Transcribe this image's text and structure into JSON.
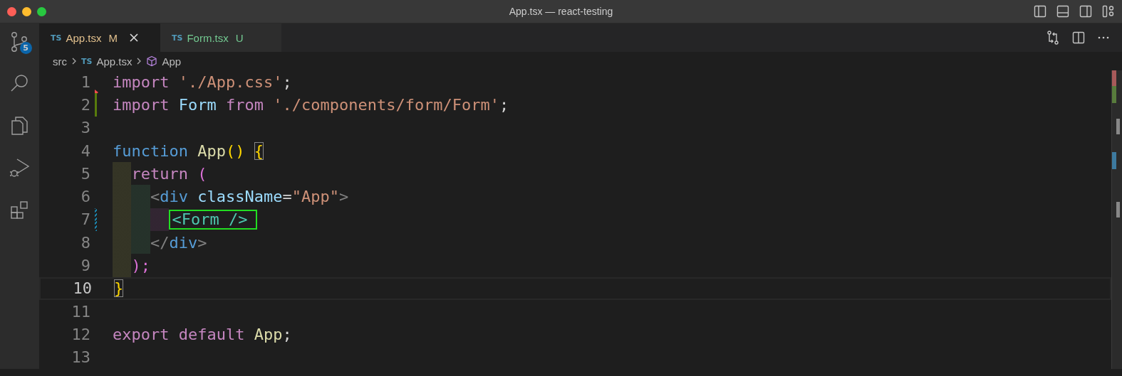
{
  "window": {
    "title": "App.tsx — react-testing"
  },
  "activity_bar": [
    {
      "kind": "source-control",
      "badge": "5",
      "selected": false
    },
    {
      "kind": "search",
      "selected": false
    },
    {
      "kind": "explorer",
      "selected": false
    },
    {
      "kind": "run-debug",
      "selected": false
    },
    {
      "kind": "extensions",
      "selected": false
    }
  ],
  "tabs": [
    {
      "icon": "TS",
      "label": "App.tsx",
      "status": "M",
      "color": "#e2c08d",
      "selected": true
    },
    {
      "icon": "TS",
      "label": "Form.tsx",
      "status": "U",
      "color": "#73c991",
      "selected": false
    }
  ],
  "breadcrumb": {
    "folder": "src",
    "file_icon": "TS",
    "file": "App.tsx",
    "symbol": "App"
  },
  "lines": [
    {
      "number": "1",
      "kind": "deleted",
      "current": false,
      "tokens": [
        {
          "text": "import",
          "kind": "keyword"
        },
        {
          "text": " './App.css'",
          "kind": "string"
        },
        {
          "text": ";"
        }
      ]
    },
    {
      "number": "2",
      "kind": "added",
      "current": false,
      "tokens": [
        {
          "text": "import",
          "kind": "keyword"
        },
        {
          "text": " Form",
          "kind": "variable"
        },
        {
          "text": " from",
          "kind": "keyword"
        },
        {
          "text": " './components/form/Form'",
          "kind": "string"
        },
        {
          "text": ";"
        }
      ]
    },
    {
      "number": "3",
      "kind": "plain",
      "current": false
    },
    {
      "number": "4",
      "kind": "plain",
      "current": false,
      "tokens": [
        {
          "text": "function",
          "kind": "storage"
        },
        {
          "text": " App",
          "kind": "function"
        },
        {
          "text": "() ",
          "kind": "bracket1"
        },
        {
          "text": "{",
          "kind": "bracket1",
          "bracket_match": true
        }
      ]
    },
    {
      "number": "5",
      "kind": "plain",
      "current": false,
      "tokens": [
        {
          "text": "  return",
          "kind": "keyword"
        },
        {
          "text": " (",
          "kind": "bracket2"
        }
      ]
    },
    {
      "number": "6",
      "kind": "plain",
      "current": false,
      "tokens": [
        {
          "text": "    <",
          "kind": "punct"
        },
        {
          "text": "div",
          "kind": "tag"
        },
        {
          "text": " className",
          "kind": "variable"
        },
        {
          "text": "="
        },
        {
          "text": "\"App\"",
          "kind": "string"
        },
        {
          "text": ">",
          "kind": "punct"
        }
      ]
    },
    {
      "number": "7",
      "kind": "modified",
      "current": false,
      "tokens": [
        {
          "text": "      <Form />",
          "kind": "component",
          "boxed": true
        }
      ]
    },
    {
      "number": "8",
      "kind": "plain",
      "current": false,
      "tokens": [
        {
          "text": "    </",
          "kind": "punct"
        },
        {
          "text": "div",
          "kind": "tag"
        },
        {
          "text": ">",
          "kind": "punct"
        }
      ]
    },
    {
      "number": "9",
      "kind": "plain",
      "current": false,
      "tokens": [
        {
          "text": "  );",
          "kind": "bracket2"
        }
      ]
    },
    {
      "number": "10",
      "kind": "plain",
      "current": true,
      "tokens": [
        {
          "text": "}",
          "kind": "bracket1",
          "bracket_match": true
        }
      ]
    },
    {
      "number": "11",
      "kind": "plain",
      "current": false
    },
    {
      "number": "12",
      "kind": "plain",
      "current": false,
      "tokens": [
        {
          "text": "export",
          "kind": "keyword"
        },
        {
          "text": " default",
          "kind": "keyword"
        },
        {
          "text": " App",
          "kind": "function"
        },
        {
          "text": ";"
        }
      ]
    },
    {
      "number": "13",
      "kind": "plain",
      "current": false
    }
  ]
}
